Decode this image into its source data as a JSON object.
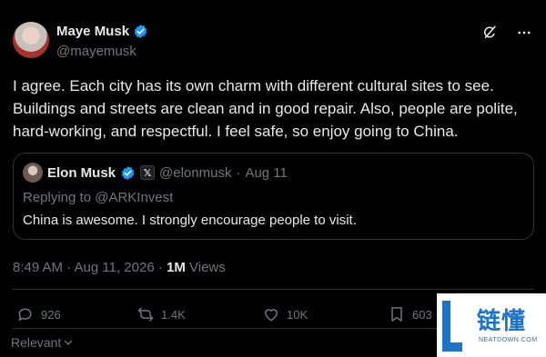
{
  "author": {
    "name": "Maye Musk",
    "handle": "@mayemusk"
  },
  "tweet": {
    "text": "I agree. Each city has its own charm with different cultural sites to see. Buildings and streets are clean and in good repair. Also, people are polite, hard-working, and respectful. I feel safe, so enjoy going to China."
  },
  "quote": {
    "name": "Elon Musk",
    "badge": "𝕏",
    "handle": "@elonmusk",
    "separator": "·",
    "date": "Aug 11",
    "replying": "Replying to @ARKInvest",
    "text": "China is awesome. I strongly encourage people to visit."
  },
  "meta": {
    "time_date": "8:49 AM · Aug 11, 2026 · ",
    "views_count": "1M",
    "views_label": " Views"
  },
  "actions": {
    "replies": "926",
    "reposts": "1.4K",
    "likes": "10K",
    "bookmarks": "603"
  },
  "sort": {
    "label": "Relevant"
  },
  "watermark": {
    "text": "链懂",
    "sub": "NEATDOWN.COM"
  },
  "colors": {
    "background": "#000000",
    "text": "#e7e9ea",
    "muted": "#71767b",
    "verified": "#1d9bf0",
    "border": "#2f3336"
  }
}
